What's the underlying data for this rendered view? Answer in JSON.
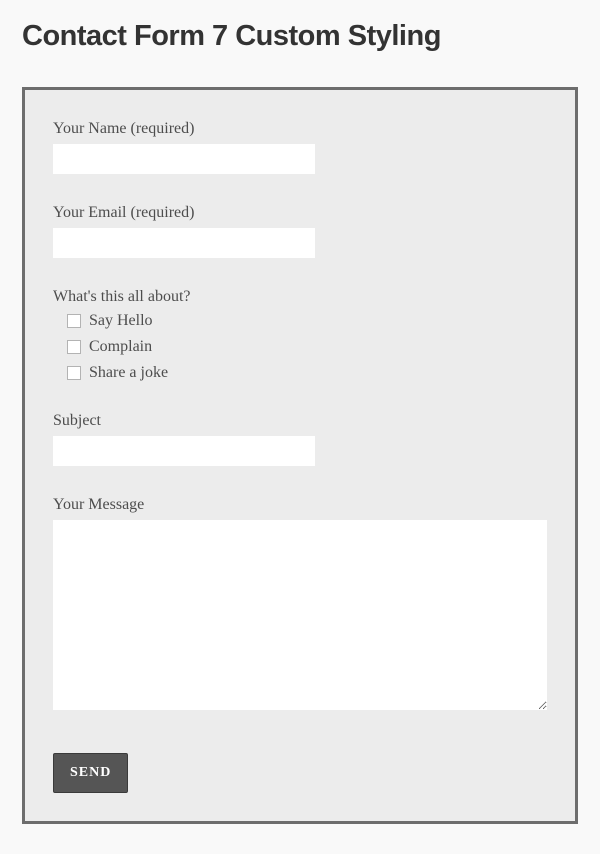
{
  "header": {
    "title": "Contact Form 7 Custom Styling"
  },
  "form": {
    "name": {
      "label": "Your Name (required)",
      "value": ""
    },
    "email": {
      "label": "Your Email (required)",
      "value": ""
    },
    "topic": {
      "label": "What's this all about?",
      "options": [
        {
          "label": "Say Hello"
        },
        {
          "label": "Complain"
        },
        {
          "label": "Share a joke"
        }
      ]
    },
    "subject": {
      "label": "Subject",
      "value": ""
    },
    "message": {
      "label": "Your Message",
      "value": ""
    },
    "submit": {
      "label": "SEND"
    }
  }
}
